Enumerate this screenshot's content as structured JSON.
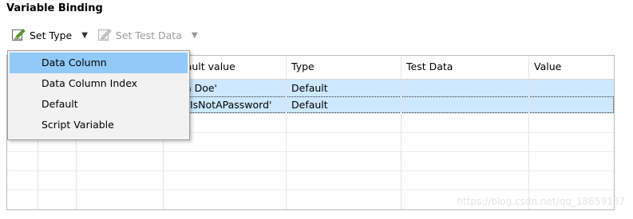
{
  "panel": {
    "title": "Variable Binding"
  },
  "toolbar": {
    "set_type": {
      "label": "Set Type",
      "icon": "edit-icon",
      "enabled": true
    },
    "set_test_data": {
      "label": "Set Test Data",
      "icon": "edit-icon",
      "enabled": false
    },
    "dropdown_glyph": "▼"
  },
  "table": {
    "columns": [
      "",
      "",
      "",
      "Default value",
      "Type",
      "Test Data",
      "Value"
    ],
    "rows": [
      {
        "default_value": "'John Doe'",
        "type": "Default",
        "test_data": "",
        "value": "",
        "selected": true,
        "focused": false
      },
      {
        "default_value": "'ThisIsNotAPassword'",
        "type": "Default",
        "test_data": "",
        "value": "",
        "selected": true,
        "focused": true
      }
    ]
  },
  "menu": {
    "items": [
      {
        "label": "Data Column",
        "active": true
      },
      {
        "label": "Data Column Index",
        "active": false
      },
      {
        "label": "Default",
        "active": false
      },
      {
        "label": "Script Variable",
        "active": false
      }
    ]
  },
  "watermark": "https://blog.csdn.net/qq_18659137",
  "colors": {
    "selection": "#cde8ff",
    "menu_highlight": "#91c9f7",
    "menu_bg": "#f2f2f2"
  }
}
